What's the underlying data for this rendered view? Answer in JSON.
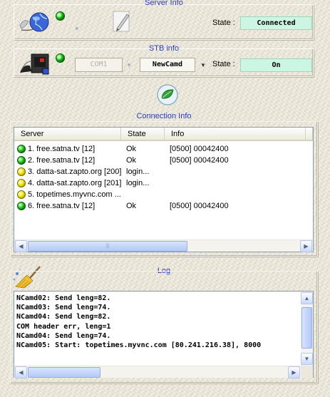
{
  "server_info": {
    "title": "Server Info",
    "state_label": "State :",
    "state_value": "Connected"
  },
  "stb_info": {
    "title": "STB info",
    "port_select": "COM1",
    "camd_select": "NewCamd",
    "state_label": "State :",
    "state_value": "On"
  },
  "connection_info": {
    "title": "Connection Info",
    "columns": [
      "Server",
      "State",
      "Info"
    ],
    "rows": [
      {
        "status": "green",
        "server": "1. free.satna.tv [12]",
        "state": "Ok",
        "info": "[0500] 00042400"
      },
      {
        "status": "green",
        "server": "2. free.satna.tv [12]",
        "state": "Ok",
        "info": "[0500] 00042400"
      },
      {
        "status": "yellow",
        "server": "3. datta-sat.zapto.org [200]",
        "state": "login...",
        "info": ""
      },
      {
        "status": "yellow",
        "server": "4. datta-sat.zapto.org [201]",
        "state": "login...",
        "info": ""
      },
      {
        "status": "yellow",
        "server": "5. topetimes.myvnc.com ...",
        "state": "",
        "info": ""
      },
      {
        "status": "green",
        "server": "6. free.satna.tv [12]",
        "state": "Ok",
        "info": "[0500] 00042400"
      }
    ]
  },
  "log": {
    "title": "Log",
    "lines": [
      "NCamd02: Send leng=82.",
      "NCamd03: Send leng=74.",
      "NCamd04: Send leng=82.",
      "COM header err, leng=1",
      "NCamd04: Send leng=74.",
      "NCamd05: Start: topetimes.myvnc.com [80.241.216.38], 8000"
    ]
  },
  "icons": {
    "server": "globe-network-icon",
    "edit": "pencil-edit-icon",
    "stb": "satellite-receiver-icon",
    "connection": "leaf-connect-icon",
    "log_clear": "broom-icon"
  },
  "colors": {
    "title_blue": "#2a3cc0",
    "state_box_bg": "#ccf5e3",
    "led_green": "#22c81e",
    "led_yellow": "#f6e800"
  }
}
